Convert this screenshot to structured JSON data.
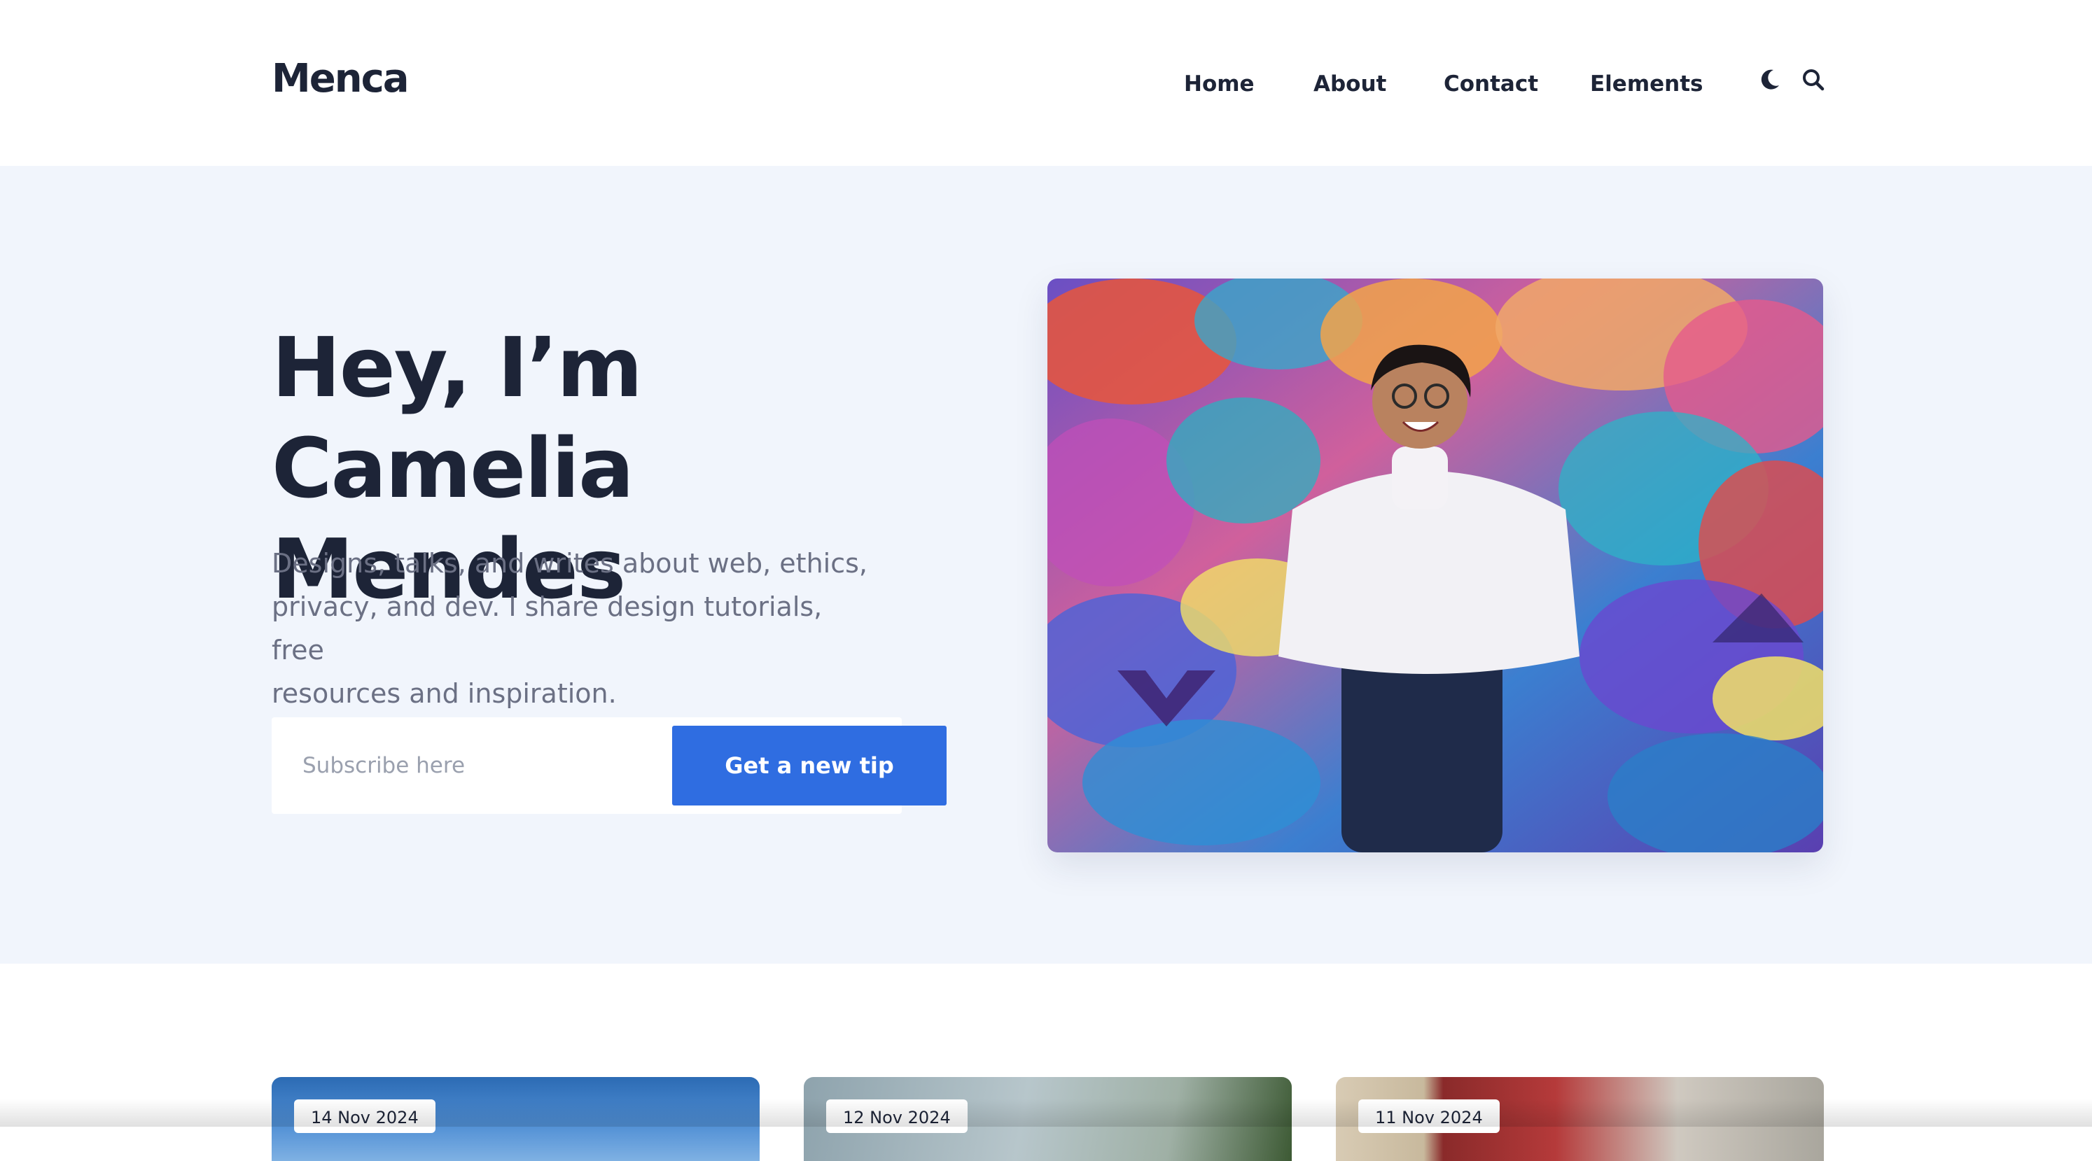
{
  "header": {
    "logo": "Menca",
    "nav": [
      "Home",
      "About",
      "Contact",
      "Elements"
    ],
    "icons": [
      "moon-icon",
      "search-icon"
    ]
  },
  "hero": {
    "title_line1": "Hey, I’m Camelia",
    "title_line2": "Mendes",
    "description_line1": "Designs, talks, and writes about web, ethics,",
    "description_line2": "privacy, and dev. I share design tutorials, free",
    "description_line3": "resources and inspiration.",
    "subscribe_placeholder": "Subscribe here",
    "subscribe_button": "Get a new tip"
  },
  "posts": [
    {
      "date": "14 Nov 2024"
    },
    {
      "date": "12 Nov 2024"
    },
    {
      "date": "11 Nov 2024"
    }
  ],
  "colors": {
    "text_dark": "#1d2437",
    "hero_bg": "#f1f5fc",
    "accent_blue": "#2f6de1",
    "muted_text": "#6b7084"
  }
}
